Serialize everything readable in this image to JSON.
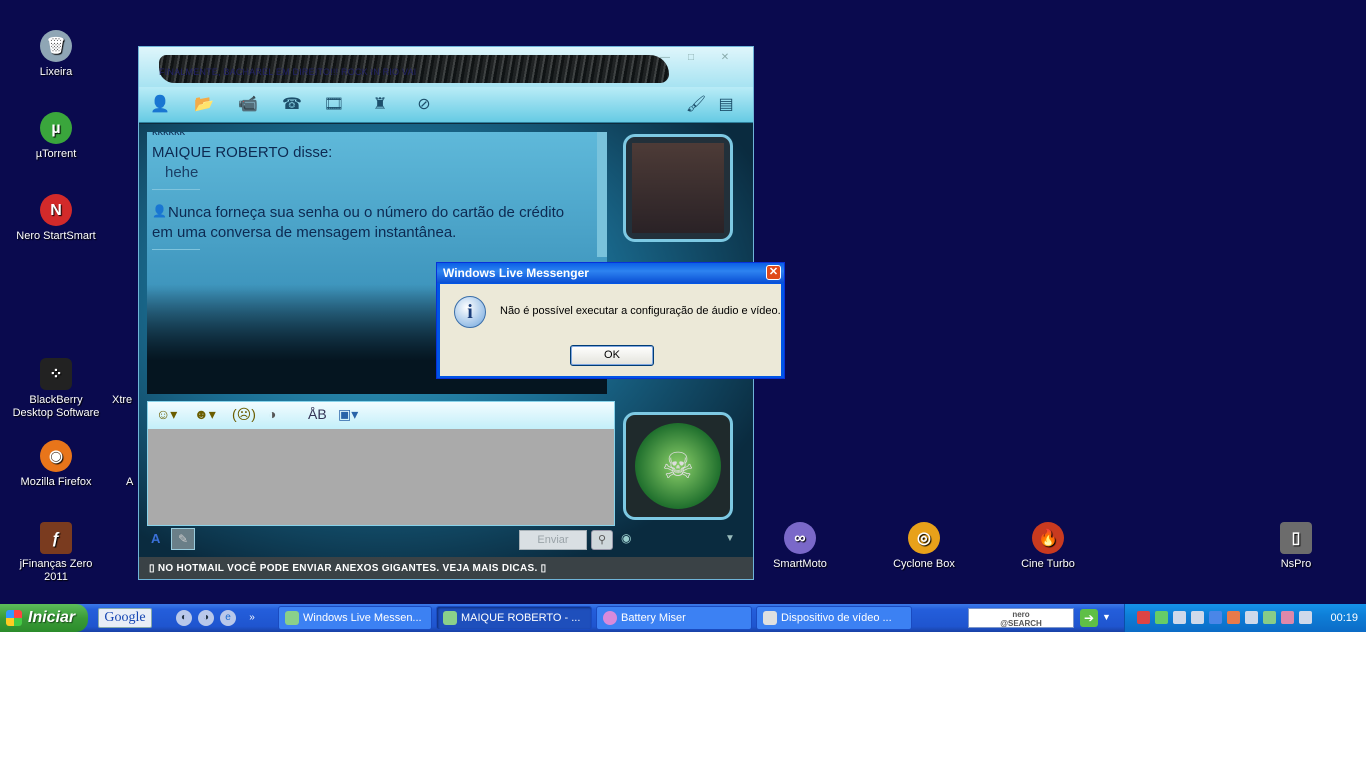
{
  "desktop": {
    "icons": [
      {
        "label": "Lixeira",
        "glyph": "🗑",
        "color": "#8fa6b5"
      },
      {
        "label": "µTorrent",
        "glyph": "µ",
        "color": "#3aa63c"
      },
      {
        "label": "Nero StartSmart",
        "glyph": "N",
        "color": "#d22a2a"
      },
      {
        "label": "BlackBerry Desktop Software",
        "glyph": "⁘",
        "color": "#222222"
      },
      {
        "label": "Mozilla Firefox",
        "glyph": "◉",
        "color": "#e8751a"
      },
      {
        "label": "jFinanças Zero 2011",
        "glyph": "ƒ",
        "color": "#7a3b1f"
      },
      {
        "label": "SmartMoto",
        "glyph": "∞",
        "color": "#7a68c9"
      },
      {
        "label": "Cyclone Box",
        "glyph": "◎",
        "color": "#e8a11a"
      },
      {
        "label": "Cine Turbo",
        "glyph": "🔥",
        "color": "#c93a1f"
      },
      {
        "label": "NsPro",
        "glyph": "▯",
        "color": "#6c6c6c"
      }
    ],
    "partial_labels": [
      "Xtre",
      "A"
    ]
  },
  "messenger": {
    "subtitle": "FINALMENTE, BACHAREL EM DIREITO!!! ROCK IN RIO VAI",
    "chat": {
      "fragment": "kkkkkk",
      "sender": "MAIQUE ROBERTO disse:",
      "message": "hehe",
      "warning_line1": "Nunca forneça sua senha ou o número do cartão de crédito",
      "warning_line2": "em uma conversa de mensagem instantânea."
    },
    "send_label": "Enviar",
    "ad_text": "▯ NO HOTMAIL VOCÊ PODE ENVIAR ANEXOS GIGANTES. VEJA MAIS DICAS. ▯"
  },
  "dialog": {
    "title": "Windows Live Messenger",
    "message": "Não é possível executar a configuração de áudio e vídeo.",
    "ok_label": "OK",
    "close_label": "✕"
  },
  "taskbar": {
    "start_label": "Iniciar",
    "google_label": "Google",
    "tasks": [
      {
        "label": "Windows Live Messen...",
        "active": false
      },
      {
        "label": "MAIQUE ROBERTO - ...",
        "active": true
      },
      {
        "label": "Battery Miser",
        "active": false
      },
      {
        "label": "Dispositivo de vídeo ...",
        "active": false
      }
    ],
    "nero_line1": "nero",
    "nero_line2": "@SEARCH",
    "clock": "00:19"
  }
}
